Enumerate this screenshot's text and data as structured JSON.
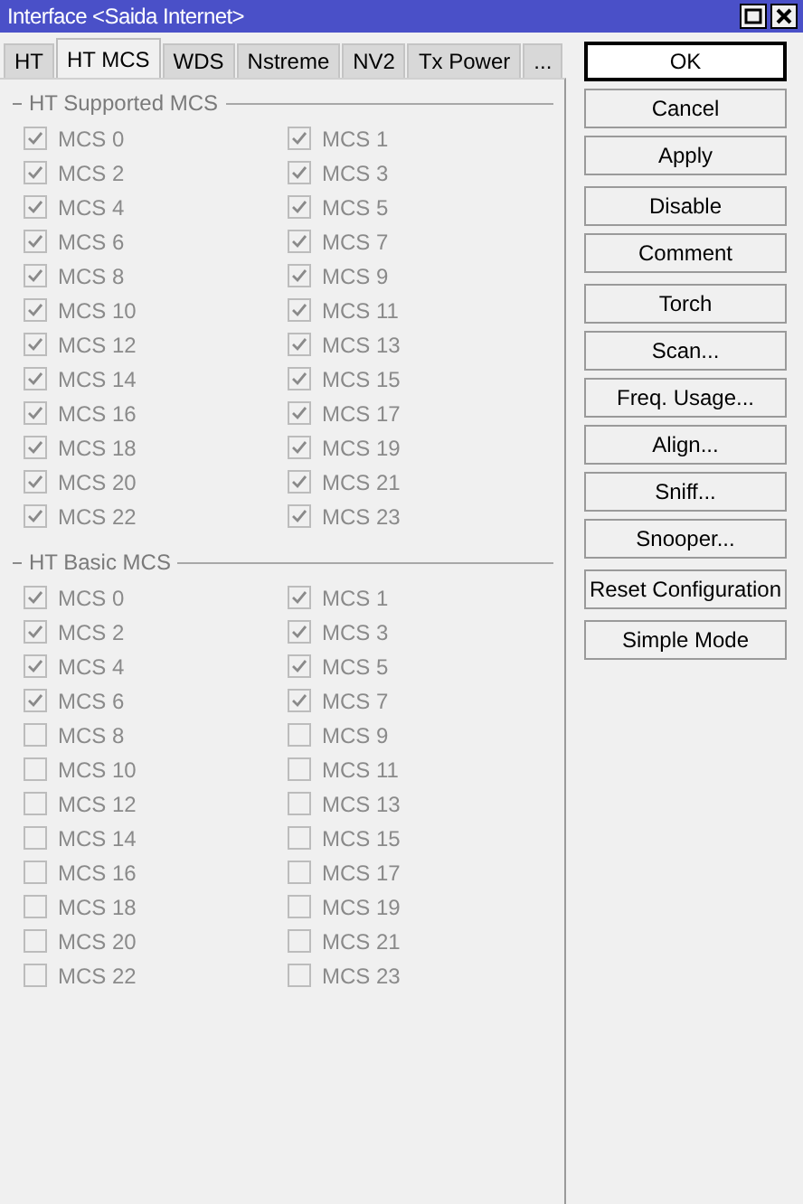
{
  "window": {
    "title": "Interface <Saida Internet>"
  },
  "tabs": [
    {
      "label": "HT",
      "selected": false
    },
    {
      "label": "HT MCS",
      "selected": true
    },
    {
      "label": "WDS",
      "selected": false
    },
    {
      "label": "Nstreme",
      "selected": false
    },
    {
      "label": "NV2",
      "selected": false
    },
    {
      "label": "Tx Power",
      "selected": false
    },
    {
      "label": "...",
      "selected": false
    }
  ],
  "sections": [
    {
      "title": "HT Supported MCS",
      "items": [
        {
          "label": "MCS 0",
          "checked": true,
          "disabled": true
        },
        {
          "label": "MCS 1",
          "checked": true,
          "disabled": true
        },
        {
          "label": "MCS 2",
          "checked": true,
          "disabled": true
        },
        {
          "label": "MCS 3",
          "checked": true,
          "disabled": true
        },
        {
          "label": "MCS 4",
          "checked": true,
          "disabled": true
        },
        {
          "label": "MCS 5",
          "checked": true,
          "disabled": true
        },
        {
          "label": "MCS 6",
          "checked": true,
          "disabled": true
        },
        {
          "label": "MCS 7",
          "checked": true,
          "disabled": true
        },
        {
          "label": "MCS 8",
          "checked": true,
          "disabled": true
        },
        {
          "label": "MCS 9",
          "checked": true,
          "disabled": true
        },
        {
          "label": "MCS 10",
          "checked": true,
          "disabled": true
        },
        {
          "label": "MCS 11",
          "checked": true,
          "disabled": true
        },
        {
          "label": "MCS 12",
          "checked": true,
          "disabled": true
        },
        {
          "label": "MCS 13",
          "checked": true,
          "disabled": true
        },
        {
          "label": "MCS 14",
          "checked": true,
          "disabled": true
        },
        {
          "label": "MCS 15",
          "checked": true,
          "disabled": true
        },
        {
          "label": "MCS 16",
          "checked": true,
          "disabled": true
        },
        {
          "label": "MCS 17",
          "checked": true,
          "disabled": true
        },
        {
          "label": "MCS 18",
          "checked": true,
          "disabled": true
        },
        {
          "label": "MCS 19",
          "checked": true,
          "disabled": true
        },
        {
          "label": "MCS 20",
          "checked": true,
          "disabled": true
        },
        {
          "label": "MCS 21",
          "checked": true,
          "disabled": true
        },
        {
          "label": "MCS 22",
          "checked": true,
          "disabled": true
        },
        {
          "label": "MCS 23",
          "checked": true,
          "disabled": true
        }
      ]
    },
    {
      "title": "HT Basic MCS",
      "items": [
        {
          "label": "MCS 0",
          "checked": true,
          "disabled": true
        },
        {
          "label": "MCS 1",
          "checked": true,
          "disabled": true
        },
        {
          "label": "MCS 2",
          "checked": true,
          "disabled": true
        },
        {
          "label": "MCS 3",
          "checked": true,
          "disabled": true
        },
        {
          "label": "MCS 4",
          "checked": true,
          "disabled": true
        },
        {
          "label": "MCS 5",
          "checked": true,
          "disabled": true
        },
        {
          "label": "MCS 6",
          "checked": true,
          "disabled": true
        },
        {
          "label": "MCS 7",
          "checked": true,
          "disabled": true
        },
        {
          "label": "MCS 8",
          "checked": false,
          "disabled": true
        },
        {
          "label": "MCS 9",
          "checked": false,
          "disabled": true
        },
        {
          "label": "MCS 10",
          "checked": false,
          "disabled": true
        },
        {
          "label": "MCS 11",
          "checked": false,
          "disabled": true
        },
        {
          "label": "MCS 12",
          "checked": false,
          "disabled": true
        },
        {
          "label": "MCS 13",
          "checked": false,
          "disabled": true
        },
        {
          "label": "MCS 14",
          "checked": false,
          "disabled": true
        },
        {
          "label": "MCS 15",
          "checked": false,
          "disabled": true
        },
        {
          "label": "MCS 16",
          "checked": false,
          "disabled": true
        },
        {
          "label": "MCS 17",
          "checked": false,
          "disabled": true
        },
        {
          "label": "MCS 18",
          "checked": false,
          "disabled": true
        },
        {
          "label": "MCS 19",
          "checked": false,
          "disabled": true
        },
        {
          "label": "MCS 20",
          "checked": false,
          "disabled": true
        },
        {
          "label": "MCS 21",
          "checked": false,
          "disabled": true
        },
        {
          "label": "MCS 22",
          "checked": false,
          "disabled": true
        },
        {
          "label": "MCS 23",
          "checked": false,
          "disabled": true
        }
      ]
    }
  ],
  "button_groups": [
    [
      {
        "label": "OK",
        "default": true
      },
      {
        "label": "Cancel",
        "default": false
      },
      {
        "label": "Apply",
        "default": false
      }
    ],
    [
      {
        "label": "Disable",
        "default": false
      },
      {
        "label": "Comment",
        "default": false
      }
    ],
    [
      {
        "label": "Torch",
        "default": false
      },
      {
        "label": "Scan...",
        "default": false
      },
      {
        "label": "Freq. Usage...",
        "default": false
      },
      {
        "label": "Align...",
        "default": false
      },
      {
        "label": "Sniff...",
        "default": false
      },
      {
        "label": "Snooper...",
        "default": false
      }
    ],
    [
      {
        "label": "Reset Configuration",
        "default": false
      }
    ],
    [
      {
        "label": "Simple Mode",
        "default": false
      }
    ]
  ]
}
